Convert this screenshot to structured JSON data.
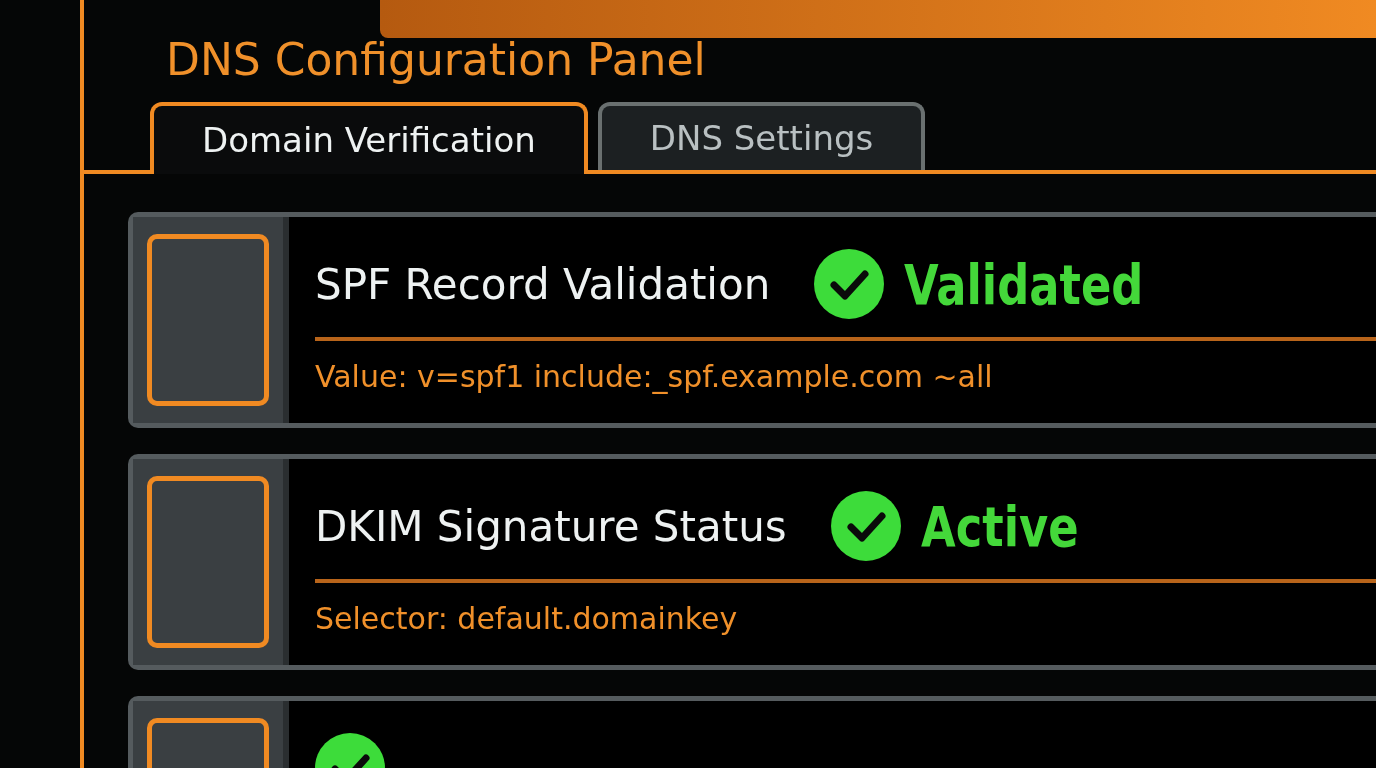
{
  "window": {
    "title": "DNS Configuration Panel"
  },
  "tabs": [
    {
      "label": "Domain Verification",
      "selected": true
    },
    {
      "label": "DNS Settings",
      "selected": false
    }
  ],
  "records": [
    {
      "checked": false,
      "name": "SPF Record Validation",
      "status": {
        "kind": "ok",
        "label": "Validated"
      },
      "detail": "Value: v=spf1 include:_spf.example.com ~all"
    },
    {
      "checked": false,
      "name": "DKIM Signature Status",
      "status": {
        "kind": "ok",
        "label": "Active"
      },
      "detail": "Selector: default.domainkey"
    },
    {
      "checked": false,
      "status": {
        "kind": "ok"
      }
    }
  ]
}
